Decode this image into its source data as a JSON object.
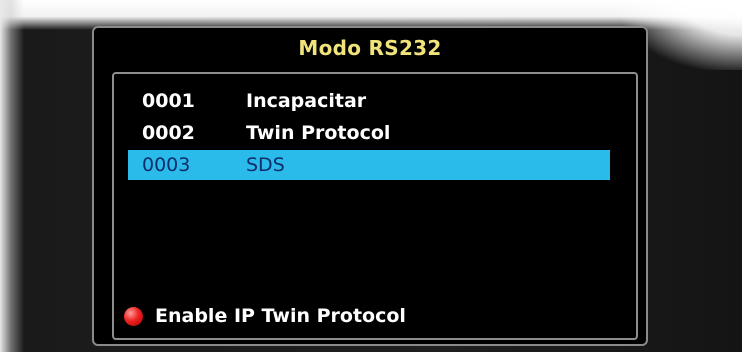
{
  "dialog": {
    "title": "Modo RS232",
    "items": [
      {
        "code": "0001",
        "label": "Incapacitar",
        "selected": false
      },
      {
        "code": "0002",
        "label": "Twin Protocol",
        "selected": false
      },
      {
        "code": "0003",
        "label": "SDS",
        "selected": true
      }
    ],
    "footer": {
      "button_color": "red",
      "label": "Enable IP Twin Protocol"
    }
  },
  "colors": {
    "title": "#f0e37a",
    "selection": "#2bbbeb",
    "selected_text": "#0d2e6b",
    "text": "#ffffff",
    "background": "#000000"
  }
}
